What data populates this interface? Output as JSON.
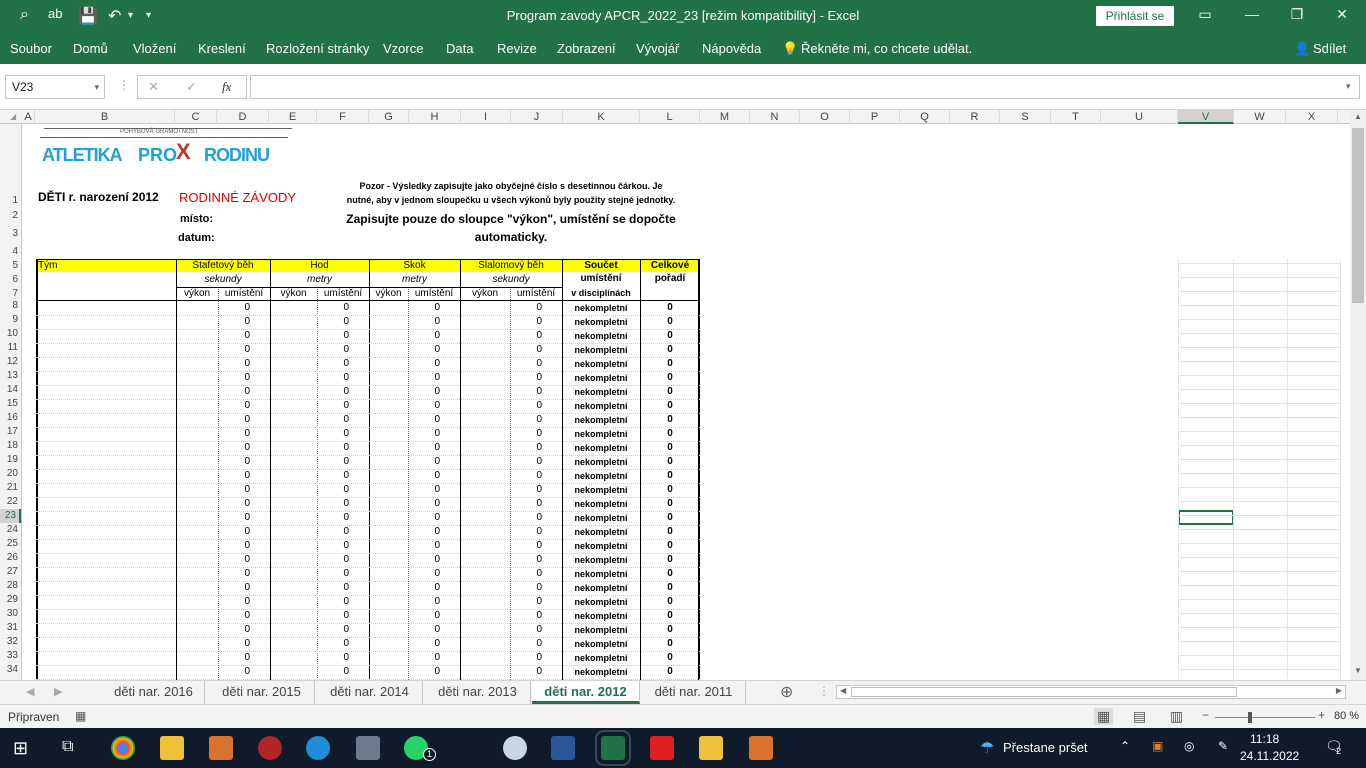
{
  "window": {
    "title": "Program zavody APCR_2022_23  [režim kompatibility]  -  Excel",
    "signin": "Přihlásit se"
  },
  "ribbon": {
    "tabs": [
      "Soubor",
      "Domů",
      "Vložení",
      "Kreslení",
      "Rozložení stránky",
      "Vzorce",
      "Data",
      "Revize",
      "Zobrazení",
      "Vývojář",
      "Nápověda"
    ],
    "tell_me": "Řekněte mi, co chcete udělat.",
    "share": "Sdílet"
  },
  "formula_bar": {
    "name_box": "V23",
    "fx": "fx",
    "formula": ""
  },
  "columns": [
    "A",
    "B",
    "C",
    "D",
    "E",
    "F",
    "G",
    "H",
    "I",
    "J",
    "K",
    "L",
    "M",
    "N",
    "O",
    "P",
    "Q",
    "R",
    "S",
    "T",
    "U",
    "V",
    "W",
    "X"
  ],
  "rows": [
    "1",
    "2",
    "3",
    "4",
    "5",
    "6",
    "7",
    "8",
    "9",
    "10",
    "11",
    "12",
    "13",
    "14",
    "15",
    "16",
    "17",
    "18",
    "19",
    "20",
    "21",
    "22",
    "23",
    "24",
    "25",
    "26",
    "27",
    "28",
    "29",
    "30",
    "31",
    "32",
    "33",
    "34"
  ],
  "sheet": {
    "logo_small": "POHYBOVÁ GRAMOTNOST",
    "logo_main": "ATLETIKA",
    "logo_pro": "PRO",
    "logo_x": "X",
    "logo_rodinu": "RODINU",
    "title_left": "DĚTI r. narození 2012",
    "title_red": "RODINNÉ ZÁVODY",
    "note_line1": "Pozor - Výsledky zapisujte jako obyčejné číslo s desetinnou čárkou. Je",
    "note_line2": "nutné, aby v jednom sloupečku u všech výkonů byly použity stejné jednotky.",
    "misto": "místo:",
    "datum": "datum:",
    "instr_line1": "Zapisujte pouze do sloupce \"výkon\", umístění se dopočte",
    "instr_line2": "automaticky.",
    "h_tym": "Tým",
    "h_stafeta": "Štafetový běh",
    "h_hod": "Hod",
    "h_skok": "Skok",
    "h_slalom": "Slalomový běh",
    "h_soucet": "Součet",
    "h_celkove": "Celkové",
    "u_sekundy": "sekundy",
    "u_metry": "metry",
    "u_metry2": "metry",
    "u_sekundy2": "sekundy",
    "h_umisteni": "umístění",
    "h_poradi": "pořadí",
    "sub_vykon": "výkon",
    "sub_umisteni": "umístění",
    "h_v_disc": "v disciplínách",
    "zero": "0",
    "nekompletni": "nekompletní"
  },
  "sheet_tabs": [
    "děti nar. 2016",
    "děti nar. 2015",
    "děti nar. 2014",
    "děti nar. 2013",
    "děti nar. 2012",
    "děti nar. 2011"
  ],
  "active_sheet": "děti nar. 2012",
  "status": {
    "ready": "Připraven",
    "zoom": "80 %"
  },
  "taskbar": {
    "weather": "Přestane pršet",
    "time": "11:18",
    "date": "24.11.2022",
    "notif": "2",
    "wa_badge": "1"
  },
  "colors": {
    "excel_green": "#217346",
    "header_yellow": "#ffff00",
    "red": "#e00000"
  }
}
